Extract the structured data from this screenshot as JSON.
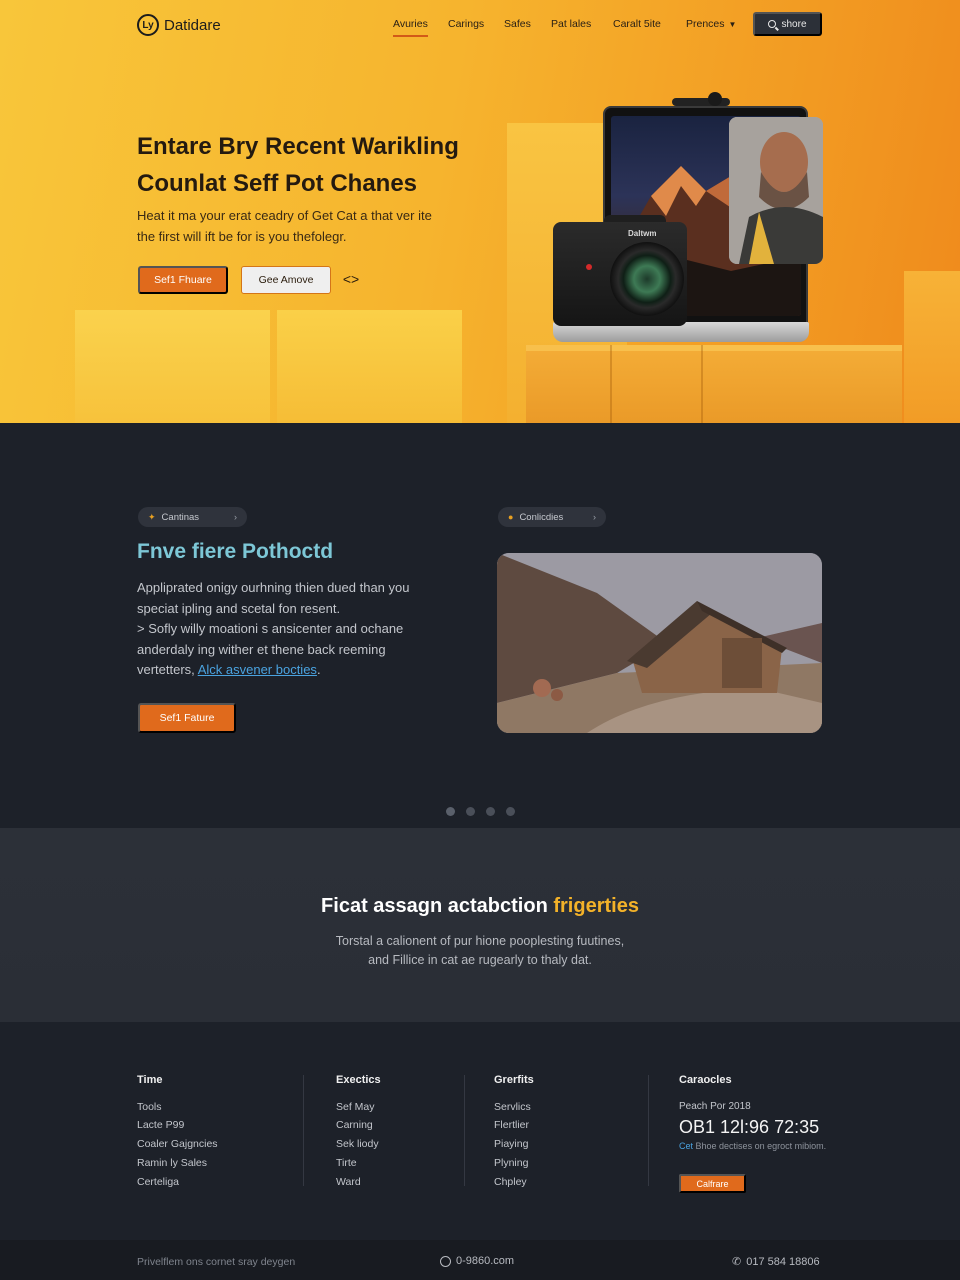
{
  "nav": {
    "logo_mark": "Ly",
    "logo_text": "Datidare",
    "links": [
      "Avuries",
      "Carings",
      "Safes",
      "Pat lales",
      "Caralt 5ite",
      "Prences"
    ],
    "search_label": "shore"
  },
  "hero": {
    "title_line1": "Entare Bry Recent Warikling",
    "title_line2": "Counlat Seff Pot Chanes",
    "subtitle_line1": "Heat it ma your erat ceadry of Get Cat a that ver ite",
    "subtitle_line2": "the first will ift be for is you thefolegr.",
    "primary_button": "Sef1 Fhuare",
    "secondary_button": "Gee Amove",
    "camera_brand": "Daltwm"
  },
  "feature": {
    "pill_left": "Cantinas",
    "pill_right": "Conlicdies",
    "title": "Fnve fiere Pothoctd",
    "body_line1": "Appliprated onigy ourhning thien dued than you",
    "body_line2": "speciat ipling and scetal fon resent.",
    "body_line3": "> Sofly willy moationi s ansicenter and ochane",
    "body_line4": "anderdaly ing wither et thene back reeming",
    "body_line5_prefix": "vertetters,",
    "body_link": "Alck asvener bocties",
    "body_line5_suffix": ".",
    "button": "Sef1 Fature",
    "carousel_dots": 4,
    "carousel_active": 0
  },
  "cta": {
    "title_main": "Ficat assagn actabction",
    "title_accent": "frigerties",
    "sub_line1": "Torstal a calionent of pur hione pooplesting fuutines,",
    "sub_line2": "and Fillice in cat ae rugearly to thaly dat."
  },
  "footer": {
    "col1": {
      "heading": "Time",
      "items": [
        "Tools",
        "Lacte P99",
        "Coaler Gajgncies",
        "Ramin ly Sales",
        "Certeliga"
      ]
    },
    "col2": {
      "heading": "Exectics",
      "items": [
        "Sef May",
        "Carning",
        "Sek liody",
        "Tirte",
        "Ward"
      ]
    },
    "col3": {
      "heading": "Grerfits",
      "items": [
        "Servlics",
        "Flertlier",
        "Piaying",
        "Plyning",
        "Chpley"
      ]
    },
    "col4": {
      "heading": "Caraocles",
      "label": "Peach Por 2018",
      "number": "OB1 12l:96 72:35",
      "note_highlight": "Cet",
      "note_rest": "Bhoe dectises on egroct mibiom.",
      "button": "Calfrare"
    }
  },
  "bottom": {
    "left": "Privelflem ons cornet sray deygen",
    "mid": "0-9860.com",
    "right": "017 584 18806"
  },
  "colors": {
    "accent_orange": "#e06a1c",
    "accent_yellow": "#f3b229",
    "feature_title": "#7dc7d6",
    "link_blue": "#4aa3e0",
    "dark_bg": "#1d2129"
  }
}
